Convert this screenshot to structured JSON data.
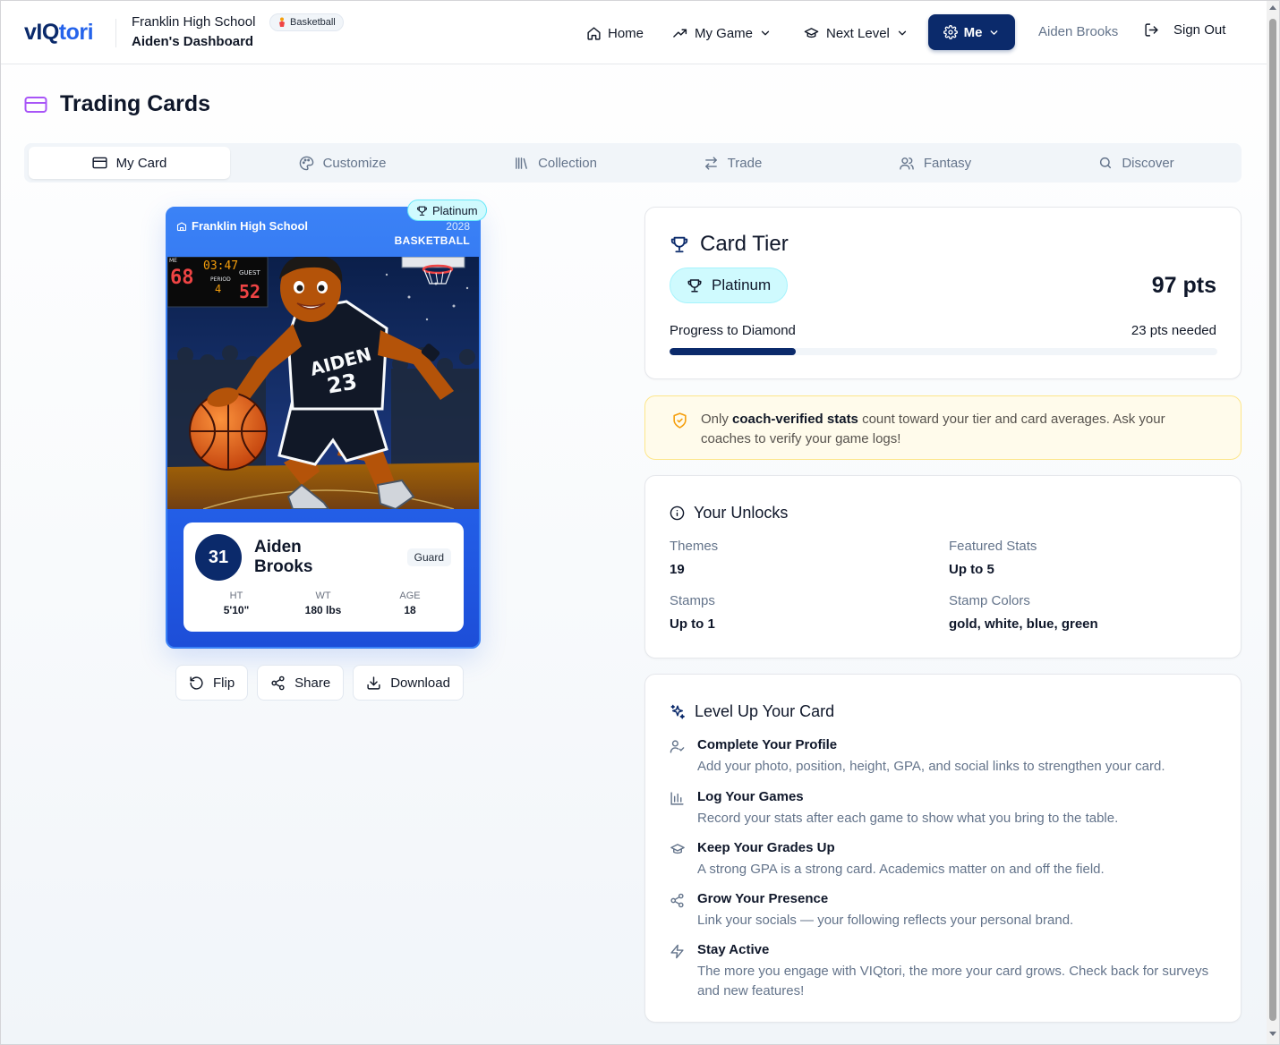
{
  "header": {
    "logo_main": "vIQ",
    "logo_accent": "tori",
    "school": "Franklin High School",
    "sport_badge": "Basketball",
    "dashboard_title": "Aiden's Dashboard",
    "nav": {
      "home": "Home",
      "my_game": "My Game",
      "next_level": "Next Level",
      "me": "Me"
    },
    "user_name": "Aiden Brooks",
    "sign_out": "Sign Out"
  },
  "page": {
    "title": "Trading Cards"
  },
  "tabs": [
    {
      "label": "My Card",
      "icon": "credit-card-icon",
      "active": true
    },
    {
      "label": "Customize",
      "icon": "palette-icon",
      "active": false
    },
    {
      "label": "Collection",
      "icon": "library-icon",
      "active": false
    },
    {
      "label": "Trade",
      "icon": "arrows-swap-icon",
      "active": false
    },
    {
      "label": "Fantasy",
      "icon": "users-icon",
      "active": false
    },
    {
      "label": "Discover",
      "icon": "search-icon",
      "active": false
    }
  ],
  "card": {
    "tier_badge": "Platinum",
    "school": "Franklin High School",
    "year": "2028",
    "sport": "BASKETBALL",
    "number": "31",
    "name": "Aiden Brooks",
    "position": "Guard",
    "stats": [
      {
        "label": "HT",
        "value": "5'10\""
      },
      {
        "label": "WT",
        "value": "180 lbs"
      },
      {
        "label": "AGE",
        "value": "18"
      }
    ],
    "illustration": {
      "jersey_name": "AIDEN",
      "jersey_number": "23",
      "scoreboard_home": "68",
      "scoreboard_clock": "03:47",
      "scoreboard_guest": "52",
      "scoreboard_period": "4",
      "scoreboard_guest_label": "GUEST",
      "scoreboard_period_label": "PERIOD",
      "scoreboard_home_label": "ME"
    }
  },
  "card_actions": {
    "flip": "Flip",
    "share": "Share",
    "download": "Download"
  },
  "tier_panel": {
    "title": "Card Tier",
    "tier": "Platinum",
    "points": "97 pts",
    "progress_label": "Progress to Diamond",
    "needed": "23 pts needed",
    "progress_fraction": 0.23
  },
  "notice": {
    "prefix": "Only ",
    "bold": "coach-verified stats",
    "suffix": " count toward your tier and card averages. Ask your coaches to verify your game logs!"
  },
  "unlocks": {
    "title": "Your Unlocks",
    "items": [
      {
        "label": "Themes",
        "value": "19"
      },
      {
        "label": "Featured Stats",
        "value": "Up to 5"
      },
      {
        "label": "Stamps",
        "value": "Up to 1"
      },
      {
        "label": "Stamp Colors",
        "value": "gold, white, blue, green"
      }
    ]
  },
  "level_up": {
    "title": "Level Up Your Card",
    "items": [
      {
        "title": "Complete Your Profile",
        "desc": "Add your photo, position, height, GPA, and social links to strengthen your card.",
        "icon": "user-check-icon"
      },
      {
        "title": "Log Your Games",
        "desc": "Record your stats after each game to show what you bring to the table.",
        "icon": "bar-chart-icon"
      },
      {
        "title": "Keep Your Grades Up",
        "desc": "A strong GPA is a strong card. Academics matter on and off the field.",
        "icon": "graduation-cap-icon"
      },
      {
        "title": "Grow Your Presence",
        "desc": "Link your socials — your following reflects your personal brand.",
        "icon": "share-icon"
      },
      {
        "title": "Stay Active",
        "desc": "The more you engage with VIQtori, the more your card grows. Check back for surveys and new features!",
        "icon": "lightning-icon"
      }
    ]
  }
}
